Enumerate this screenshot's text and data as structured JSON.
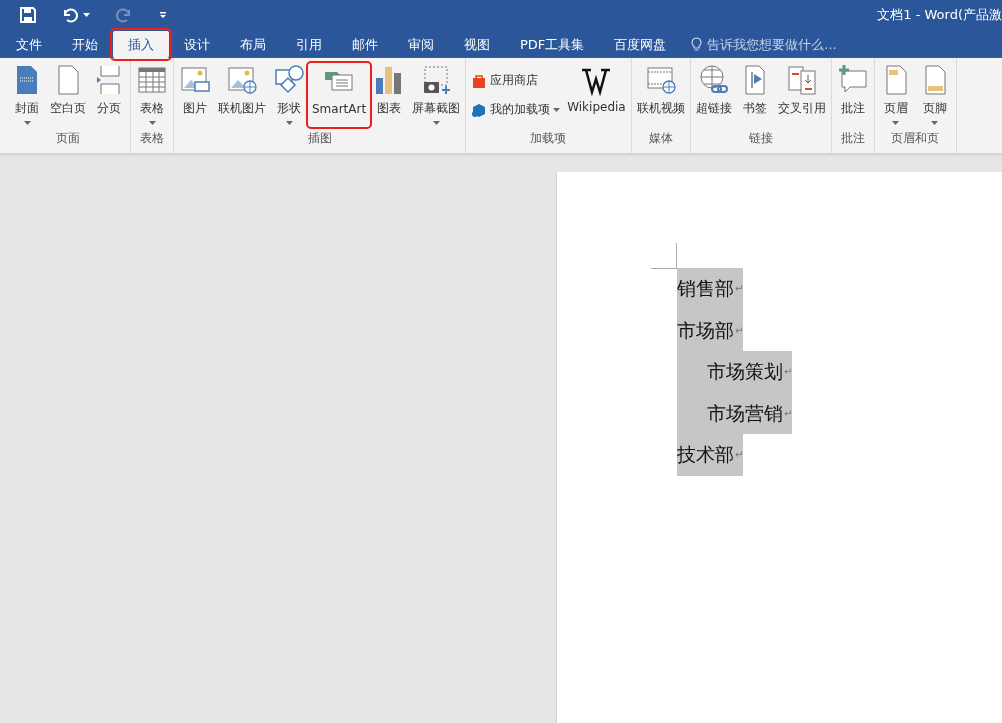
{
  "window": {
    "title": "文档1 - Word(产品激"
  },
  "quick_access": [
    {
      "kind": "save",
      "disabled": false,
      "dropdown": false
    },
    {
      "kind": "undo",
      "disabled": false,
      "dropdown": true
    },
    {
      "kind": "redo",
      "disabled": true,
      "dropdown": false
    },
    {
      "kind": "customize",
      "disabled": false,
      "dropdown": false
    }
  ],
  "tabs": [
    {
      "label": "文件",
      "selected": false,
      "highlighted": false
    },
    {
      "label": "开始",
      "selected": false,
      "highlighted": false
    },
    {
      "label": "插入",
      "selected": true,
      "highlighted": true
    },
    {
      "label": "设计",
      "selected": false,
      "highlighted": false
    },
    {
      "label": "布局",
      "selected": false,
      "highlighted": false
    },
    {
      "label": "引用",
      "selected": false,
      "highlighted": false
    },
    {
      "label": "邮件",
      "selected": false,
      "highlighted": false
    },
    {
      "label": "审阅",
      "selected": false,
      "highlighted": false
    },
    {
      "label": "视图",
      "selected": false,
      "highlighted": false
    },
    {
      "label": "PDF工具集",
      "selected": false,
      "highlighted": false
    },
    {
      "label": "百度网盘",
      "selected": false,
      "highlighted": false
    }
  ],
  "tell_me": {
    "placeholder": "告诉我您想要做什么..."
  },
  "ribbon_groups": [
    {
      "label": "页面",
      "buttons": [
        {
          "kind": "large",
          "label": "封面",
          "dropdown": true,
          "highlighted": false
        },
        {
          "kind": "large",
          "label": "空白页",
          "dropdown": false,
          "highlighted": false
        },
        {
          "kind": "large",
          "label": "分页",
          "dropdown": false,
          "highlighted": false
        }
      ]
    },
    {
      "label": "表格",
      "buttons": [
        {
          "kind": "large",
          "label": "表格",
          "dropdown": true,
          "highlighted": false
        }
      ]
    },
    {
      "label": "插图",
      "buttons": [
        {
          "kind": "large",
          "label": "图片",
          "dropdown": false,
          "highlighted": false
        },
        {
          "kind": "large",
          "label": "联机图片",
          "dropdown": false,
          "highlighted": false
        },
        {
          "kind": "large",
          "label": "形状",
          "dropdown": true,
          "highlighted": false
        },
        {
          "kind": "large",
          "label": "SmartArt",
          "dropdown": false,
          "highlighted": true
        },
        {
          "kind": "large",
          "label": "图表",
          "dropdown": false,
          "highlighted": false
        },
        {
          "kind": "large",
          "label": "屏幕截图",
          "dropdown": true,
          "highlighted": false
        }
      ]
    },
    {
      "label": "加载项",
      "buttons": [
        {
          "kind": "small",
          "label": "应用商店",
          "dropdown": false,
          "highlighted": false
        },
        {
          "kind": "small",
          "label": "我的加载项",
          "dropdown": true,
          "highlighted": false
        },
        {
          "kind": "large",
          "label": "Wikipedia",
          "dropdown": false,
          "highlighted": false
        }
      ]
    },
    {
      "label": "媒体",
      "buttons": [
        {
          "kind": "large",
          "label": "联机视频",
          "dropdown": false,
          "highlighted": false
        }
      ]
    },
    {
      "label": "链接",
      "buttons": [
        {
          "kind": "large",
          "label": "超链接",
          "dropdown": false,
          "highlighted": false
        },
        {
          "kind": "large",
          "label": "书签",
          "dropdown": false,
          "highlighted": false
        },
        {
          "kind": "large",
          "label": "交叉引用",
          "dropdown": false,
          "highlighted": false
        }
      ]
    },
    {
      "label": "批注",
      "buttons": [
        {
          "kind": "large",
          "label": "批注",
          "dropdown": false,
          "highlighted": false
        }
      ]
    },
    {
      "label": "页眉和页",
      "buttons": [
        {
          "kind": "large",
          "label": "页眉",
          "dropdown": true,
          "highlighted": false
        },
        {
          "kind": "large",
          "label": "页脚",
          "dropdown": true,
          "highlighted": false
        }
      ]
    }
  ],
  "document": {
    "paragraphs": [
      {
        "text": "销售部 ",
        "mark": "↵",
        "selected": true
      },
      {
        "text": "市场部",
        "mark": "↵",
        "selected": true,
        "children": [
          {
            "text": "市场策划",
            "mark": "↵",
            "selected": true
          },
          {
            "text": "市场营销",
            "mark": "↵",
            "selected": true
          }
        ]
      },
      {
        "text": "技术部",
        "mark": "↵",
        "selected": true
      }
    ]
  }
}
